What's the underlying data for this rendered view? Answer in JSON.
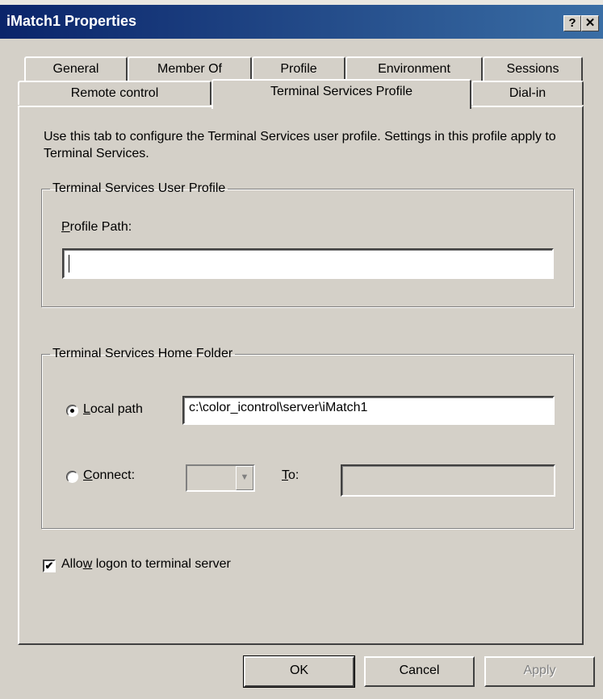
{
  "window": {
    "title": "iMatch1 Properties",
    "help_label": "?",
    "close_label": "✕"
  },
  "tabs": {
    "row1": [
      "General",
      "Member Of",
      "Profile",
      "Environment",
      "Sessions"
    ],
    "row2": [
      "Remote control",
      "Terminal Services Profile",
      "Dial-in"
    ],
    "selected": "Terminal Services Profile"
  },
  "panel": {
    "intro": "Use this tab to configure the Terminal Services user profile. Settings in this profile apply to Terminal Services.",
    "user_profile": {
      "legend": "Terminal Services User Profile",
      "profile_path_label_access": "P",
      "profile_path_label_rest": "rofile Path:",
      "profile_path_value": ""
    },
    "home_folder": {
      "legend": "Terminal Services Home Folder",
      "local_path_access": "L",
      "local_path_rest": "ocal path",
      "local_path_selected": true,
      "local_path_value": "c:\\color_icontrol\\server\\iMatch1",
      "connect_access": "C",
      "connect_rest": "onnect:",
      "connect_drive_value": "",
      "to_access": "T",
      "to_rest": "o:",
      "to_value": ""
    },
    "allow_logon": {
      "label_pre": "Allo",
      "label_access": "w",
      "label_post": " logon to terminal server",
      "checked": true
    }
  },
  "buttons": {
    "ok": "OK",
    "cancel": "Cancel",
    "apply": "Apply"
  }
}
